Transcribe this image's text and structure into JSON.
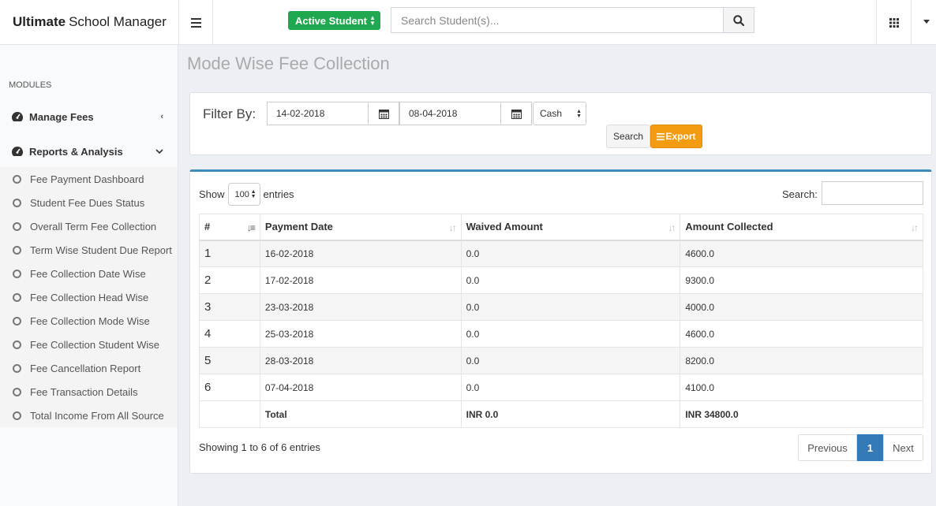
{
  "app": {
    "title_bold": "Ultimate",
    "title_rest": "School Manager"
  },
  "header": {
    "student_filter": "Active Student",
    "search_placeholder": "Search Student(s)..."
  },
  "sidebar": {
    "section_label": "MODULES",
    "items": [
      {
        "label": "Manage Fees",
        "arrow": "‹"
      },
      {
        "label": "Reports & Analysis",
        "arrow": "⌄"
      }
    ],
    "subitems": [
      "Fee Payment Dashboard",
      "Student Fee Dues Status",
      "Overall Term Fee Collection",
      "Term Wise Student Due Report",
      "Fee Collection Date Wise",
      "Fee Collection Head Wise",
      "Fee Collection Mode Wise",
      "Fee Collection Student Wise",
      "Fee Cancellation Report",
      "Fee Transaction Details",
      "Total Income From All Source"
    ]
  },
  "page": {
    "title": "Mode Wise Fee Collection"
  },
  "filter": {
    "label": "Filter By:",
    "from_date": "14-02-2018",
    "to_date": "08-04-2018",
    "mode": "Cash",
    "search_btn": "Search",
    "export_btn": "Export"
  },
  "table": {
    "show_label": "Show",
    "entries_value": "100",
    "entries_label": "entries",
    "search_label": "Search:",
    "columns": [
      "#",
      "Payment Date",
      "Waived Amount",
      "Amount Collected"
    ],
    "rows": [
      {
        "no": "1",
        "date": "16-02-2018",
        "waived": "0.0",
        "collected": "4600.0"
      },
      {
        "no": "2",
        "date": "17-02-2018",
        "waived": "0.0",
        "collected": "9300.0"
      },
      {
        "no": "3",
        "date": "23-03-2018",
        "waived": "0.0",
        "collected": "4000.0"
      },
      {
        "no": "4",
        "date": "25-03-2018",
        "waived": "0.0",
        "collected": "4600.0"
      },
      {
        "no": "5",
        "date": "28-03-2018",
        "waived": "0.0",
        "collected": "8200.0"
      },
      {
        "no": "6",
        "date": "07-04-2018",
        "waived": "0.0",
        "collected": "4100.0"
      }
    ],
    "total": {
      "label": "Total",
      "waived": "INR 0.0",
      "collected": "INR 34800.0"
    },
    "info": "Showing 1 to 6 of 6 entries",
    "pagination": {
      "prev": "Previous",
      "current": "1",
      "next": "Next"
    }
  },
  "colors": {
    "accent": "#3c8dbc",
    "success": "#1fa84f",
    "warning": "#f39c12"
  }
}
